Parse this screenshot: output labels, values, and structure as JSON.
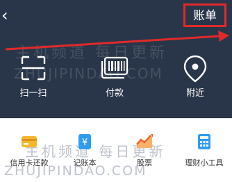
{
  "header": {
    "bill_label": "账单",
    "background": "#293649",
    "highlight_color": "#e02a2a"
  },
  "actions": [
    {
      "label": "扫一扫",
      "icon": "scan-icon"
    },
    {
      "label": "付款",
      "icon": "payment-code-icon"
    },
    {
      "label": "附近",
      "icon": "location-pin-icon"
    }
  ],
  "quick_tools": [
    {
      "label": "信用卡还款",
      "icon": "credit-card-icon",
      "color": "#f6b62c"
    },
    {
      "label": "记账本",
      "icon": "ledger-icon",
      "color": "#2e9cf0"
    },
    {
      "label": "股票",
      "icon": "stock-chart-icon",
      "color": "#f0642a"
    },
    {
      "label": "理财小工具",
      "icon": "calculator-icon",
      "color": "#2e9cf0"
    }
  ],
  "watermark": {
    "cn": "主机频道 每日更新",
    "en": "ZHUJIPINDAO.COM"
  }
}
